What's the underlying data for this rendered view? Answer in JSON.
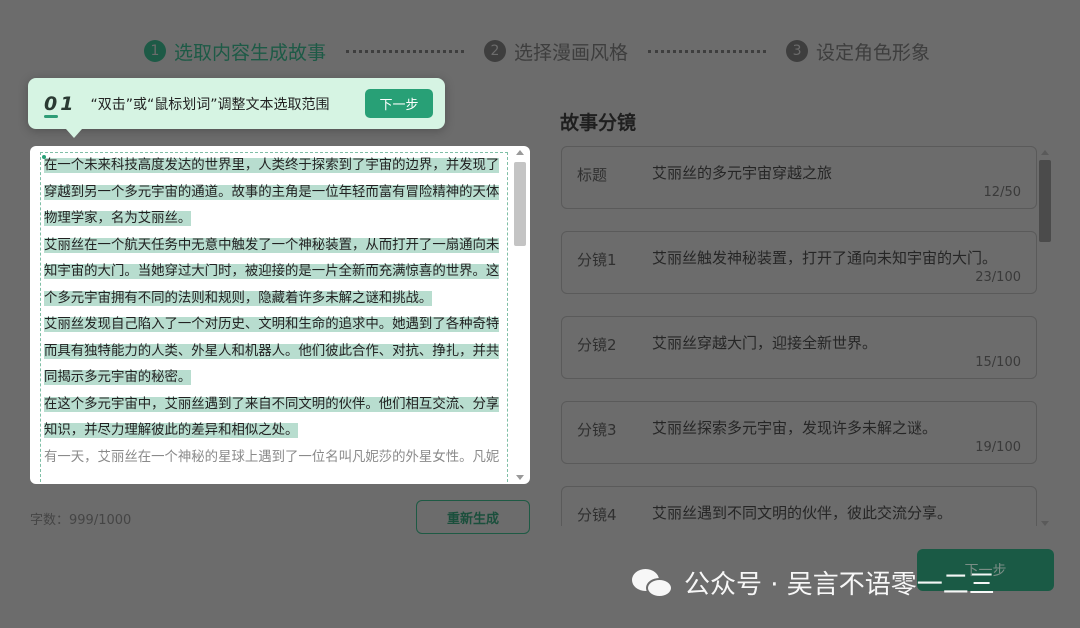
{
  "steps": [
    {
      "num": "1",
      "label": "选取内容生成故事"
    },
    {
      "num": "2",
      "label": "选择漫画风格"
    },
    {
      "num": "3",
      "label": "设定角色形象"
    }
  ],
  "tip": {
    "index": "01",
    "text": "“双击”或“鼠标划词”调整文本选取范围",
    "button": "下一步"
  },
  "editor": {
    "paragraphs": [
      "在一个未来科技高度发达的世界里，人类终于探索到了宇宙的边界，并发现了穿越到另一个多元宇宙的通道。故事的主角是一位年轻而富有冒险精神的天体物理学家，名为艾丽丝。",
      "艾丽丝在一个航天任务中无意中触发了一个神秘装置，从而打开了一扇通向未知宇宙的大门。当她穿过大门时，被迎接的是一片全新而充满惊喜的世界。这个多元宇宙拥有不同的法则和规则，隐藏着许多未解之谜和挑战。",
      "艾丽丝发现自己陷入了一个对历史、文明和生命的追求中。她遇到了各种奇特而具有独特能力的人类、外星人和机器人。他们彼此合作、对抗、挣扎，并共同揭示多元宇宙的秘密。",
      "在这个多元宇宙中，艾丽丝遇到了来自不同文明的伙伴。他们相互交流、分享知识，并尽力理解彼此的差异和相似之处。",
      "有一天，艾丽丝在一个神秘的星球上遇到了一位名叫凡妮莎的外星女性。凡妮"
    ],
    "word_count": "字数：999/1000",
    "regenerate": "重新生成"
  },
  "storyboard": {
    "title": "故事分镜",
    "cards": [
      {
        "label": "标题",
        "text": "艾丽丝的多元宇宙穿越之旅",
        "count": "12/50"
      },
      {
        "label": "分镜1",
        "text": "艾丽丝触发神秘装置，打开了通向未知宇宙的大门。",
        "count": "23/100"
      },
      {
        "label": "分镜2",
        "text": "艾丽丝穿越大门，迎接全新世界。",
        "count": "15/100"
      },
      {
        "label": "分镜3",
        "text": "艾丽丝探索多元宇宙，发现许多未解之谜。",
        "count": "19/100"
      },
      {
        "label": "分镜4",
        "text": "艾丽丝遇到不同文明的伙伴，彼此交流分享。",
        "count": ""
      }
    ],
    "next": "下一步"
  },
  "watermark": "公众号 · 吴言不语零一二三",
  "colors": {
    "accent": "#28a076",
    "overlay": "#6c6c6c",
    "highlight": "#b8ddcf"
  }
}
